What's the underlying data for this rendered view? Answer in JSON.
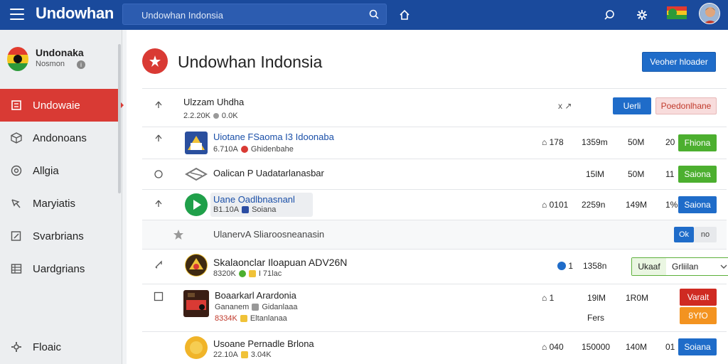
{
  "app": {
    "brand": "Undowhan"
  },
  "search": {
    "placeholder": "Undowhan Indonsia"
  },
  "sidebar": {
    "profile_name": "Undonaka",
    "profile_sub": "Nosmon",
    "items": [
      {
        "label": "Undowaie",
        "icon": "book-icon"
      },
      {
        "label": "Andonoans",
        "icon": "cube-icon"
      },
      {
        "label": "Allgia",
        "icon": "coin-icon"
      },
      {
        "label": "Maryiatis",
        "icon": "pin-icon"
      },
      {
        "label": "Svarbrians",
        "icon": "edit-icon"
      },
      {
        "label": "Uardgrians",
        "icon": "grid-icon"
      }
    ],
    "bottom_item": "Floaic"
  },
  "main": {
    "title": "Undowhan Indonsia",
    "primary_button": "Veoher hloader",
    "rows": [
      {
        "title": "Ulzzam Uhdha",
        "sub": "2.2.20K",
        "sub2": "0.0K",
        "controls": "x ↗",
        "btn1": "Uerli",
        "btn2": "Poedonlhane"
      },
      {
        "title": "Uiotane FSaoma I3 Idoonaba",
        "sub": "6.710A",
        "sub2": "Ghidenbahe",
        "c1": "178",
        "c2": "1359m",
        "c3": "50M",
        "c4": "20",
        "btn": "Fhiona"
      },
      {
        "title": "Oalican P Uadatarlanasbar",
        "c2": "15lM",
        "c3": "50M",
        "c4": "11",
        "btn": "Saiona"
      },
      {
        "title": "Uane Oadlbnasnanl",
        "sub": "B1.10A",
        "sub2": "Soiana",
        "c1": "0101",
        "c2": "2259n",
        "c3": "149M",
        "c4": "1%",
        "btn": "Saiona"
      },
      {
        "title": "UlanervA Sliaroosneanasin",
        "toggle_on": "Ok",
        "toggle_off": "no"
      },
      {
        "title": "Skalaonclar Iloapuan ADV26N",
        "sub": "8320K",
        "sub2": "I 71lac",
        "c1": "1",
        "c2": "1358n",
        "select_a": "Ukaaf",
        "select_b": "Grliilan"
      },
      {
        "title": "Boaarkarl Arardonia",
        "sub": "Gananem",
        "sub2": "Gidanlaaa",
        "sub3": "8334K",
        "sub4": "Eltanlanaa",
        "c1": "1",
        "c2": "19lM",
        "c3": "1R0M",
        "extra": "Fers",
        "btn_red": "Varalt",
        "btn_orange": "8YfO"
      },
      {
        "title": "Usoane Pernadle Brlona",
        "sub": "22.10A",
        "sub2": "3.04K",
        "c1": "040",
        "c2": "150000",
        "c3": "140M",
        "c4": "01",
        "btn": "Soiana"
      }
    ]
  },
  "colors": {
    "topbar": "#1a4a9c",
    "accent": "#d93a34",
    "primary": "#1f6cc9",
    "green": "#4caf2f"
  }
}
